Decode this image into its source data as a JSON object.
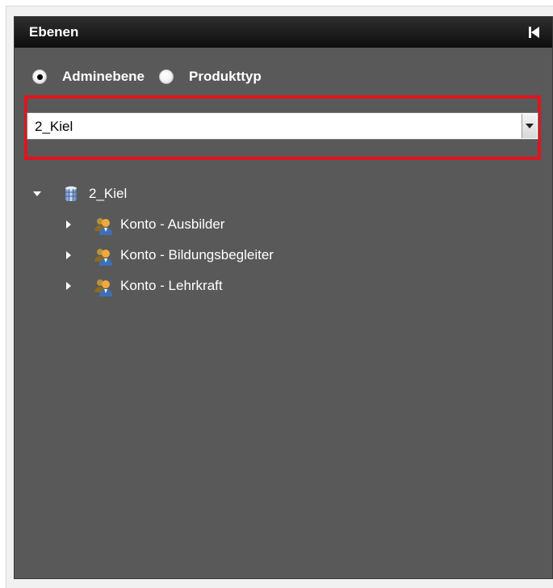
{
  "panel": {
    "title": "Ebenen",
    "collapse_icon": "collapse-left-icon"
  },
  "radios": [
    {
      "label": "Adminebene",
      "selected": true
    },
    {
      "label": "Produkttyp",
      "selected": false
    }
  ],
  "select": {
    "value": "2_Kiel",
    "arrow_icon": "dropdown-arrow-icon"
  },
  "highlight_color": "#e0141e",
  "tree": {
    "root": {
      "label": "2_Kiel",
      "icon": "database-icon",
      "expanded": true
    },
    "children": [
      {
        "label": "Konto - Ausbilder",
        "icon": "user-group-icon",
        "expanded": false
      },
      {
        "label": "Konto - Bildungsbegleiter",
        "icon": "user-group-icon",
        "expanded": false
      },
      {
        "label": "Konto - Lehrkraft",
        "icon": "user-group-icon",
        "expanded": false
      }
    ]
  },
  "colors": {
    "panel_bg": "#595959",
    "header_bg": "#1a1a1a",
    "text": "#ffffff"
  }
}
